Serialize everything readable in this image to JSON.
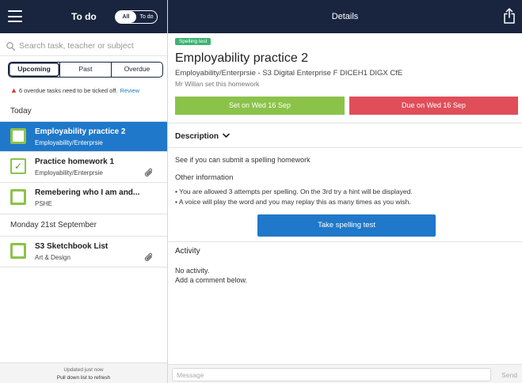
{
  "header": {
    "menu_icon": "hamburger-menu-icon",
    "left_title": "To do",
    "toggle": {
      "all": "All",
      "todo": "To do",
      "selected": "All"
    },
    "right_title": "Details",
    "share_icon": "share-icon"
  },
  "search": {
    "placeholder": "Search task, teacher or subject",
    "icon": "search-icon"
  },
  "tabs": [
    "Upcoming",
    "Past",
    "Overdue"
  ],
  "active_tab": "Upcoming",
  "overdue_warning": {
    "text": "6 overdue tasks need to be ticked off.",
    "link": "Review",
    "icon": "warning-icon",
    "color": "#e03131"
  },
  "sections": [
    {
      "heading": "Today",
      "tasks": [
        {
          "title": "Employability practice 2",
          "subject": "Employability/Enterprsie",
          "selected": true,
          "done": false,
          "attachment": false
        },
        {
          "title": "Practice homework 1",
          "subject": "Employability/Enterprsie",
          "selected": false,
          "done": true,
          "attachment": true
        },
        {
          "title": "Remebering who I am and...",
          "subject": "PSHE",
          "selected": false,
          "done": false,
          "attachment": false
        }
      ]
    },
    {
      "heading": "Monday 21st September",
      "tasks": [
        {
          "title": "S3 Sketchbook List",
          "subject": "Art & Design",
          "selected": false,
          "done": false,
          "attachment": true
        }
      ]
    }
  ],
  "left_footer": {
    "updated": "Updated just now",
    "hint": "Pull down list to refresh"
  },
  "detail": {
    "badge": "Spelling test",
    "title": "Employability practice 2",
    "subtitle": "Employability/Enterprsie - S3 Digital Enterprise F DICEH1 DIGX CfE",
    "teacher": "Mr Willan set this homework",
    "set_date": "Set on Wed 16 Sep",
    "due_date": "Due on Wed 16 Sep",
    "description_heading": "Description",
    "description": "See if you can submit a spelling homework",
    "other_heading": "Other information",
    "bullets": [
      "• You are allowed 3 attempts per spelling. On the 3rd try a hint will be displayed.",
      "• A voice will play the word and you may replay this as many times as you wish."
    ],
    "action_button": "Take spelling test",
    "activity_heading": "Activity",
    "activity_lines": [
      "No activity.",
      "Add a comment below."
    ]
  },
  "composer": {
    "placeholder": "Message",
    "send": "Send"
  },
  "colors": {
    "nav": "#19253f",
    "accent_blue": "#1f78c9",
    "green": "#8bc34a",
    "red": "#e04e5a",
    "badge_green": "#3cb371"
  }
}
